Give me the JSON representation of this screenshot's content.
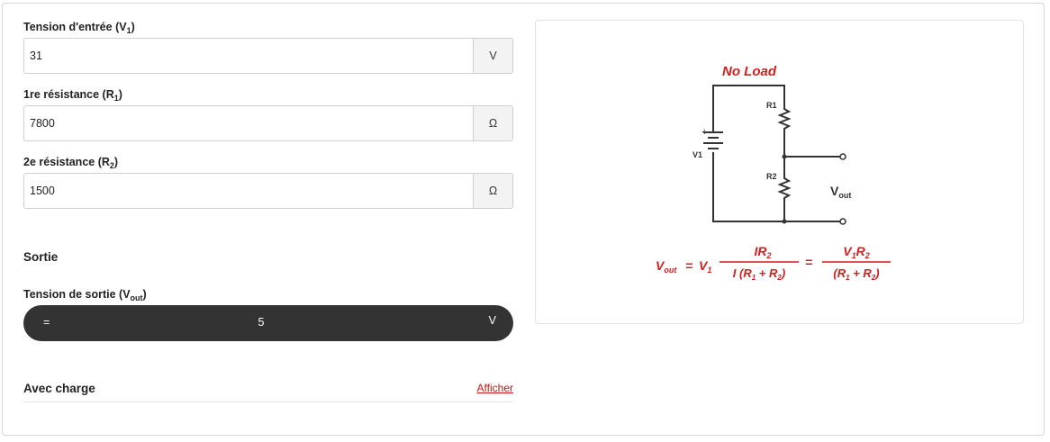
{
  "inputs": {
    "v1": {
      "label": "Tension d'entrée (",
      "sub": "1",
      "var": "V",
      "value": "31",
      "unit": "V"
    },
    "r1": {
      "label": "1re résistance (",
      "sub": "1",
      "var": "R",
      "value": "7800",
      "unit": "Ω"
    },
    "r2": {
      "label": "2e résistance (",
      "sub": "2",
      "var": "R",
      "value": "1500",
      "unit": "Ω"
    }
  },
  "output": {
    "section_title": "Sortie",
    "label": "Tension de sortie (",
    "label_var": "V",
    "label_sub": "out",
    "equals": "=",
    "value": "5",
    "unit": "V"
  },
  "load": {
    "title": "Avec charge",
    "toggle_label": "Afficher"
  },
  "diagram": {
    "title": "No Load",
    "labels": {
      "r1": "R1",
      "r2": "R2",
      "v1": "V1",
      "plus": "+",
      "vout": "V",
      "vout_sub": "out"
    },
    "formula": {
      "lhs": "V",
      "lhs_sub": "out",
      "eq": "=",
      "v1": "V",
      "v1_sub": "1",
      "num1": "IR",
      "num1_sub": "2",
      "den1": "I (R",
      "den1_sub1": "1",
      "den1_mid": " + R",
      "den1_sub2": "2",
      "den1_end": ")",
      "num2": "V",
      "num2_sub1": "1",
      "num2_mid": "R",
      "num2_sub2": "2",
      "den2": "(R",
      "den2_sub1": "1",
      "den2_mid": " + R",
      "den2_sub2": "2",
      "den2_end": ")"
    },
    "accent_color": "#d21f1f"
  }
}
